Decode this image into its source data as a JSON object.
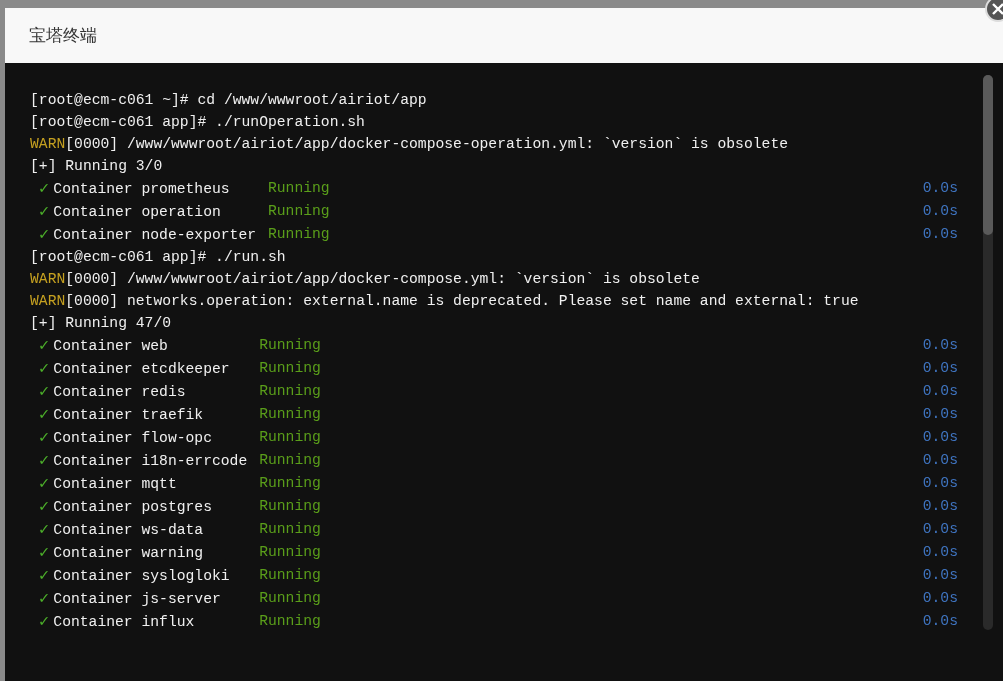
{
  "dialog": {
    "title": "宝塔终端"
  },
  "terminal": {
    "lines": [
      {
        "kind": "plain",
        "text": "[root@ecm-c061 ~]# cd /www/wwwroot/airiot/app"
      },
      {
        "kind": "plain",
        "text": "[root@ecm-c061 app]# ./runOperation.sh"
      },
      {
        "kind": "warn",
        "level": "WARN",
        "text": "[0000] /www/wwwroot/airiot/app/docker-compose-operation.yml: `version` is obsolete"
      },
      {
        "kind": "plain",
        "text": "[+] Running 3/0"
      },
      {
        "kind": "group",
        "rows": [
          {
            "check": "✓",
            "name": "Container prometheus",
            "status": "Running",
            "time": "0.0s"
          },
          {
            "check": "✓",
            "name": "Container operation",
            "status": "Running",
            "time": "0.0s"
          },
          {
            "check": "✓",
            "name": "Container node-exporter",
            "status": "Running",
            "time": "0.0s"
          }
        ]
      },
      {
        "kind": "plain",
        "text": "[root@ecm-c061 app]# ./run.sh"
      },
      {
        "kind": "warn",
        "level": "WARN",
        "text": "[0000] /www/wwwroot/airiot/app/docker-compose.yml: `version` is obsolete"
      },
      {
        "kind": "warn",
        "level": "WARN",
        "text": "[0000] networks.operation: external.name is deprecated. Please set name and external: true"
      },
      {
        "kind": "plain",
        "text": "[+] Running 47/0"
      },
      {
        "kind": "group",
        "rows": [
          {
            "check": "✓",
            "name": "Container web",
            "status": "Running",
            "time": "0.0s"
          },
          {
            "check": "✓",
            "name": "Container etcdkeeper",
            "status": "Running",
            "time": "0.0s"
          },
          {
            "check": "✓",
            "name": "Container redis",
            "status": "Running",
            "time": "0.0s"
          },
          {
            "check": "✓",
            "name": "Container traefik",
            "status": "Running",
            "time": "0.0s"
          },
          {
            "check": "✓",
            "name": "Container flow-opc",
            "status": "Running",
            "time": "0.0s"
          },
          {
            "check": "✓",
            "name": "Container i18n-errcode",
            "status": "Running",
            "time": "0.0s"
          },
          {
            "check": "✓",
            "name": "Container mqtt",
            "status": "Running",
            "time": "0.0s"
          },
          {
            "check": "✓",
            "name": "Container postgres",
            "status": "Running",
            "time": "0.0s"
          },
          {
            "check": "✓",
            "name": "Container ws-data",
            "status": "Running",
            "time": "0.0s"
          },
          {
            "check": "✓",
            "name": "Container warning",
            "status": "Running",
            "time": "0.0s"
          },
          {
            "check": "✓",
            "name": "Container syslogloki",
            "status": "Running",
            "time": "0.0s"
          },
          {
            "check": "✓",
            "name": "Container js-server",
            "status": "Running",
            "time": "0.0s"
          },
          {
            "check": "✓",
            "name": "Container influx",
            "status": "Running",
            "time": "0.0s"
          }
        ]
      }
    ]
  }
}
